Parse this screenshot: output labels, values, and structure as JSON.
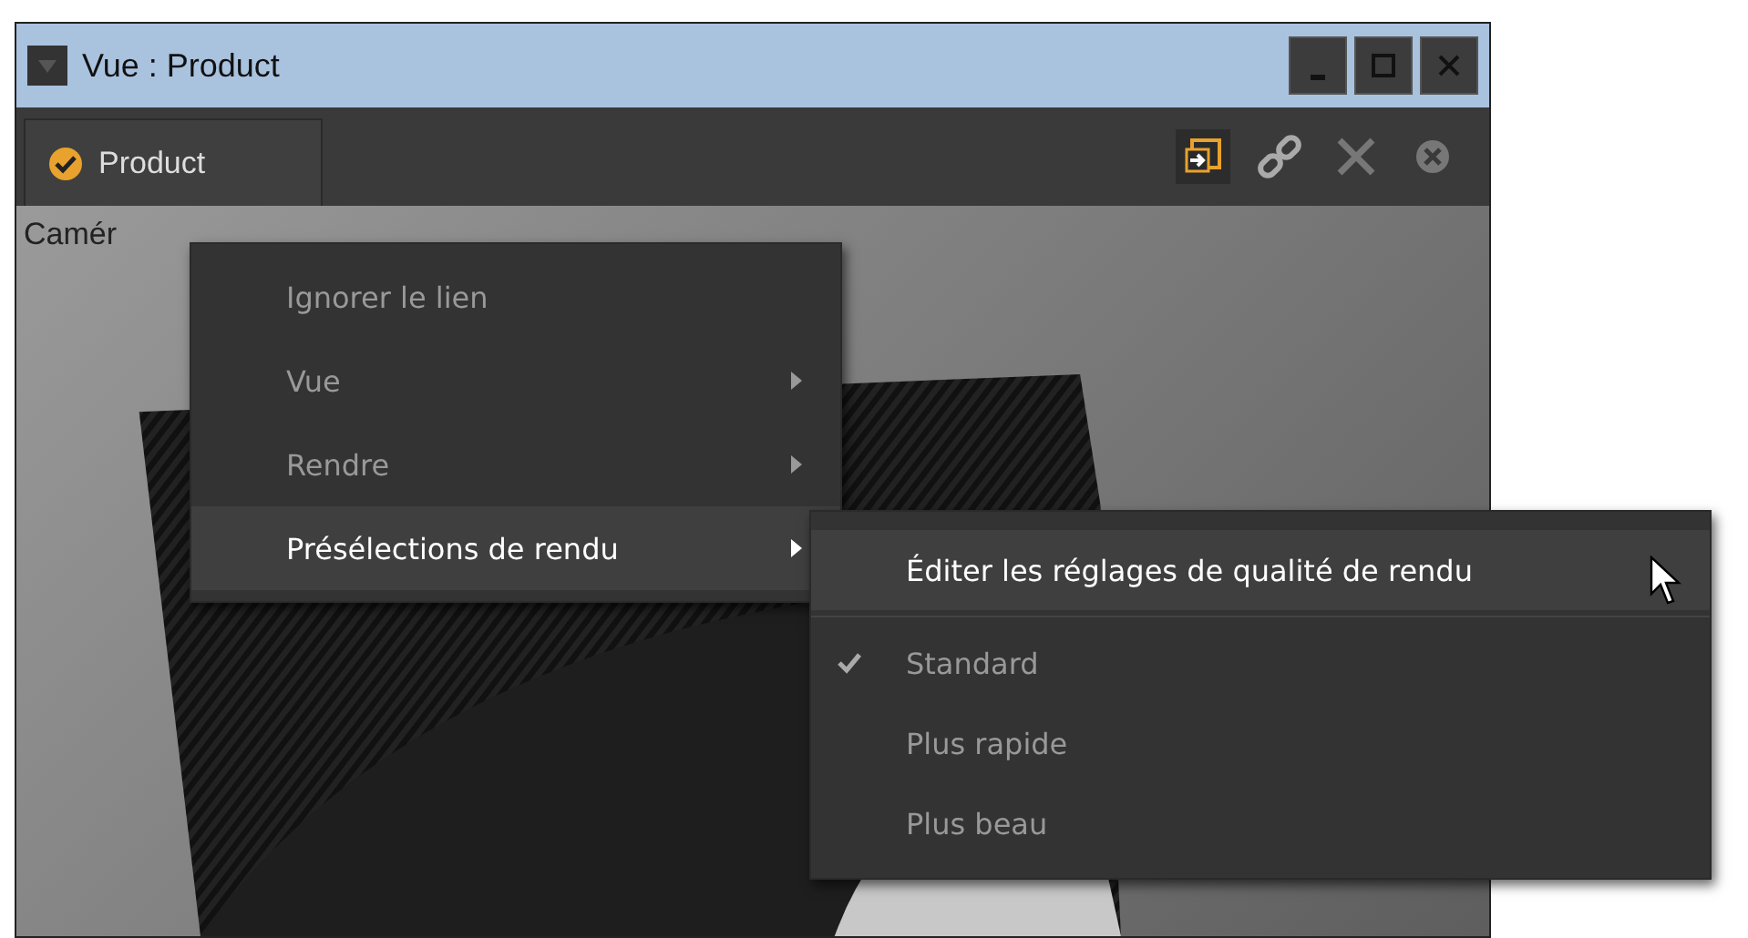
{
  "window": {
    "title": "Vue : Product"
  },
  "tabs": [
    {
      "label": "Product",
      "selected": true
    }
  ],
  "viewport": {
    "camera_label": "Camér"
  },
  "context_menu": {
    "items": [
      {
        "label": "Ignorer le lien",
        "submenu": false,
        "highlighted": false
      },
      {
        "label": "Vue",
        "submenu": true,
        "highlighted": false
      },
      {
        "label": "Rendre",
        "submenu": true,
        "highlighted": false
      },
      {
        "label": "Présélections de rendu",
        "submenu": true,
        "highlighted": true
      }
    ]
  },
  "submenu": {
    "items": [
      {
        "kind": "action",
        "label": "Éditer les réglages de qualité de rendu",
        "highlighted": true
      },
      {
        "kind": "separator"
      },
      {
        "kind": "option",
        "label": "Standard",
        "checked": true,
        "highlighted": false
      },
      {
        "kind": "option",
        "label": "Plus rapide",
        "checked": false,
        "highlighted": false
      },
      {
        "kind": "option",
        "label": "Plus beau",
        "checked": false,
        "highlighted": false
      }
    ]
  }
}
